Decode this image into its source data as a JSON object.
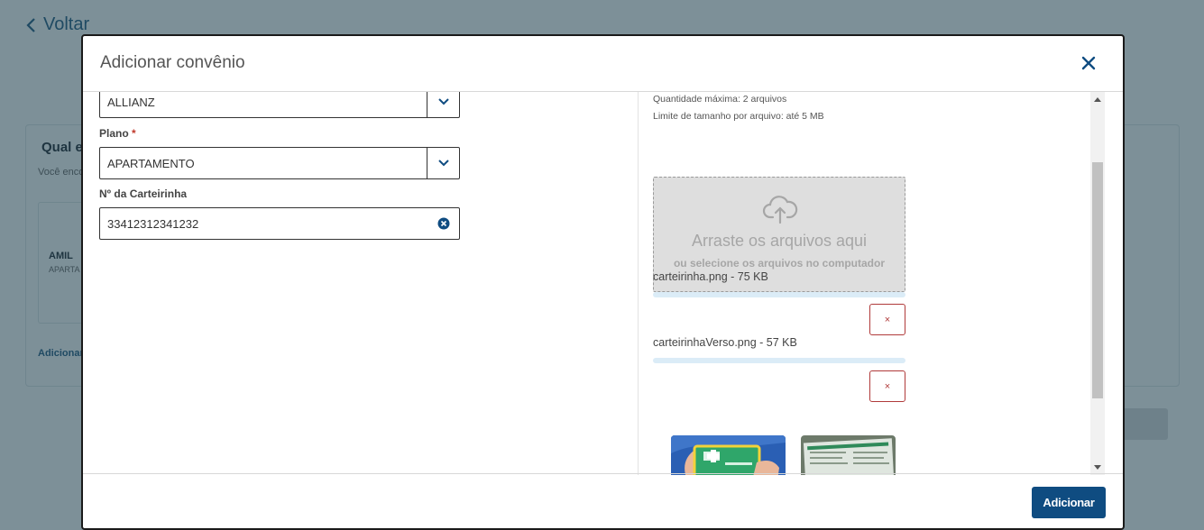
{
  "background": {
    "back_label": "Voltar",
    "card_title": "Qual e",
    "card_subtitle": "Você enco",
    "plan_name": "AMIL",
    "plan_type": "APARTA",
    "add_link": "Adicionar"
  },
  "modal": {
    "title": "Adicionar convênio",
    "close_icon": "close-icon",
    "left": {
      "insurer_value": "ALLIANZ",
      "plan_label": "Plano",
      "plan_required_mark": "*",
      "plan_value": "APARTAMENTO",
      "card_number_label": "Nº da Carteirinha",
      "card_number_value": "33412312341232"
    },
    "right": {
      "max_files_hint": "Quantidade máxima: 2 arquivos",
      "size_limit_hint": "Limite de tamanho por arquivo: até 5 MB",
      "dropzone_title": "Arraste os arquivos aqui",
      "dropzone_subtitle": "ou selecione os arquivos no computador",
      "files": [
        {
          "name": "carteirinha.png - 75 KB",
          "remove_label": "×",
          "progress": 1.0
        },
        {
          "name": "carteirinhaVerso.png - 57 KB",
          "remove_label": "×",
          "progress": 1.0
        }
      ]
    },
    "footer": {
      "submit_label": "Adicionar"
    }
  },
  "colors": {
    "overlay": "#7d9098",
    "primary": "#0f4c81",
    "danger": "#b03a3a",
    "progress": "#dbecf7"
  }
}
